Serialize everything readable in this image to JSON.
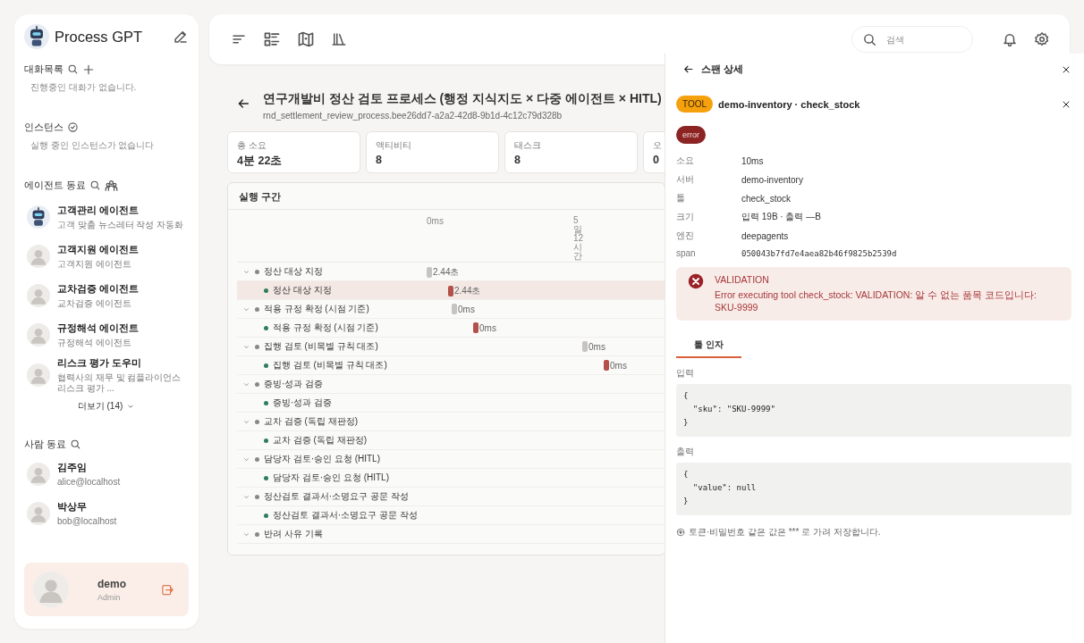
{
  "sidebar": {
    "brand": "Process GPT",
    "conversations": {
      "title": "대화목록",
      "empty_text": "진행중인 대화가 없습니다."
    },
    "instances": {
      "title": "인스턴스",
      "empty_text": "실행 중인 인스턴스가 없습니다"
    },
    "agents": {
      "title": "에이전트 동료",
      "items": [
        {
          "name": "고객관리 에이전트",
          "description": "고객 맞춤 뉴스레터 작성 자동화",
          "kind": "robot"
        },
        {
          "name": "고객지원 에이전트",
          "description": "고객지원 에이전트",
          "kind": "person"
        },
        {
          "name": "교차검증 에이전트",
          "description": "교차검증 에이전트",
          "kind": "person"
        },
        {
          "name": "규정해석 에이전트",
          "description": "규정해석 에이전트",
          "kind": "person"
        },
        {
          "name": "리스크 평가 도우미",
          "description": "협력사의 재무 및 컴플라이언스 리스크 평가 ...",
          "kind": "person"
        }
      ],
      "more": "더보기 (14)"
    },
    "people": {
      "title": "사람 동료",
      "items": [
        {
          "name": "김주임",
          "email": "alice@localhost"
        },
        {
          "name": "박상무",
          "email": "bob@localhost"
        }
      ]
    },
    "user": {
      "name": "demo",
      "role": "Admin"
    }
  },
  "topbar": {
    "search": {
      "placeholder": "검색"
    }
  },
  "process": {
    "title": "연구개발비 정산 검토 프로세스 (행정 지식지도 × 다중 에이전트 × HITL)",
    "id": "rnd_settlement_review_process.bee26dd7-a2a2-42d8-9b1d-4c12c79d328b",
    "stats": [
      {
        "label": "총 소요",
        "value": "4분 22초"
      },
      {
        "label": "액티비티",
        "value": "8"
      },
      {
        "label": "태스크",
        "value": "8"
      },
      {
        "label": "오",
        "value": "0"
      }
    ],
    "timeline": {
      "title": "실행 구간",
      "ticks": [
        "0ms",
        "5일12시간"
      ],
      "groups": [
        {
          "label": "정산 대상 지정",
          "expanded": true,
          "bar": {
            "kind": "start",
            "label": "2.44초"
          },
          "children": [
            {
              "label": "정산 대상 지정",
              "selected": true,
              "bar": {
                "kind": "start",
                "label": "2.44초"
              }
            }
          ]
        },
        {
          "label": "적용 규정 확정 (시점 기준)",
          "expanded": true,
          "bar": {
            "kind": "early",
            "label": "0ms"
          },
          "children": [
            {
              "label": "적용 규정 확정 (시점 기준)",
              "selected": false,
              "bar": {
                "kind": "early",
                "label": "0ms"
              }
            }
          ]
        },
        {
          "label": "집행 검토 (비목별 규칙 대조)",
          "expanded": true,
          "bar": {
            "kind": "late",
            "label": "0ms"
          },
          "children": [
            {
              "label": "집행 검토 (비목별 규칙 대조)",
              "selected": false,
              "bar": {
                "kind": "late",
                "label": "0ms"
              }
            }
          ]
        },
        {
          "label": "증빙·성과 검증",
          "expanded": true,
          "children": [
            {
              "label": "증빙·성과 검증",
              "selected": false
            }
          ]
        },
        {
          "label": "교차 검증 (독립 재판정)",
          "expanded": true,
          "children": [
            {
              "label": "교차 검증 (독립 재판정)",
              "selected": false
            }
          ]
        },
        {
          "label": "담당자 검토·승인 요청 (HITL)",
          "expanded": true,
          "children": [
            {
              "label": "담당자 검토·승인 요청 (HITL)",
              "selected": false
            }
          ]
        },
        {
          "label": "정산검토 결과서·소명요구 공문 작성",
          "expanded": true,
          "children": [
            {
              "label": "정산검토 결과서·소명요구 공문 작성",
              "selected": false
            }
          ]
        },
        {
          "label": "반려 사유 기록",
          "expanded": true
        }
      ]
    }
  },
  "drawer": {
    "title": "스팬 상세",
    "badge": "TOOL",
    "span_title": "demo-inventory · check_stock",
    "status": "error",
    "fields": [
      {
        "key": "소요",
        "value": "10ms",
        "kind": "text"
      },
      {
        "key": "서버",
        "value": "demo-inventory",
        "kind": "text"
      },
      {
        "key": "툴",
        "value": "check_stock",
        "kind": "text"
      },
      {
        "key": "크기",
        "value": "입력 19B · 출력 —B",
        "kind": "text"
      },
      {
        "key": "엔진",
        "value": "deepagents",
        "kind": "text"
      },
      {
        "key": "span",
        "value": "050043b7fd7e4aea82b46f9825b2539d",
        "kind": "mono"
      }
    ],
    "error": {
      "code": "VALIDATION",
      "message": "Error executing tool check_stock: VALIDATION: 알 수 없는 품목 코드입니다: SKU-9999"
    },
    "tabs": [
      {
        "label": "툴 인자",
        "selected": true
      }
    ],
    "input": {
      "label": "입력",
      "code": "{\n  \"sku\": \"SKU-9999\"\n}"
    },
    "output": {
      "label": "출력",
      "code": "{\n  \"value\": null\n}"
    },
    "note": "토큰·비밀번호 같은 값은 *** 로 가려 저장합니다."
  }
}
